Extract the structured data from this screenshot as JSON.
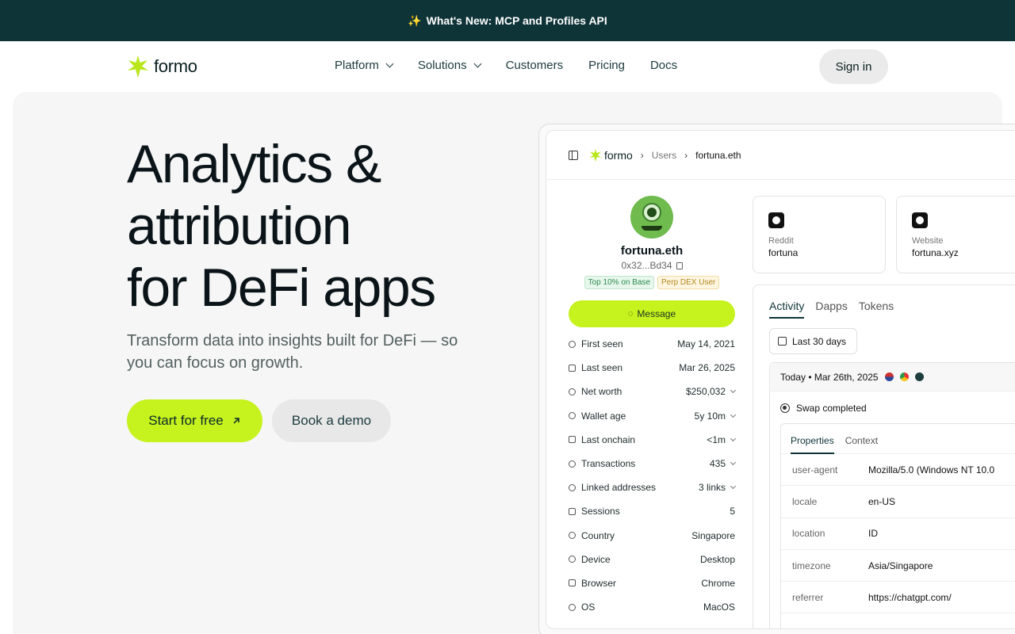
{
  "announcement": {
    "icon": "sparkles-icon",
    "text": "What's New: MCP and Profiles API"
  },
  "nav": {
    "logo": "formo",
    "items": [
      {
        "label": "Platform",
        "dropdown": true
      },
      {
        "label": "Solutions",
        "dropdown": true
      },
      {
        "label": "Customers",
        "dropdown": false
      },
      {
        "label": "Pricing",
        "dropdown": false
      },
      {
        "label": "Docs",
        "dropdown": false
      }
    ],
    "signin": "Sign in"
  },
  "hero": {
    "headline": [
      "Analytics &",
      "attribution",
      "for DeFi apps"
    ],
    "subtitle": "Transform data into insights built for DeFi — so you can focus on growth.",
    "primary_cta": "Start for free",
    "secondary_cta": "Book a demo"
  },
  "app": {
    "logo": "formo",
    "breadcrumb": [
      "Users",
      "fortuna.eth"
    ],
    "profile": {
      "name": "fortuna.eth",
      "address": "0x32...Bd34",
      "tags": [
        "Top 10% on Base",
        "Perp DEX User"
      ],
      "message_button": "Message",
      "rows": [
        {
          "label": "First seen",
          "value": "May 14, 2021",
          "expand": false
        },
        {
          "label": "Last seen",
          "value": "Mar 26, 2025",
          "expand": false
        },
        {
          "label": "Net worth",
          "value": "$250,032",
          "expand": true
        },
        {
          "label": "Wallet age",
          "value": "5y 10m",
          "expand": true
        },
        {
          "label": "Last onchain",
          "value": "<1m",
          "expand": true
        },
        {
          "label": "Transactions",
          "value": "435",
          "expand": true
        },
        {
          "label": "Linked addresses",
          "value": "3 links",
          "expand": true
        },
        {
          "label": "Sessions",
          "value": "5",
          "expand": false
        },
        {
          "label": "Country",
          "value": "Singapore",
          "expand": false
        },
        {
          "label": "Device",
          "value": "Desktop",
          "expand": false
        },
        {
          "label": "Browser",
          "value": "Chrome",
          "expand": false
        },
        {
          "label": "OS",
          "value": "MacOS",
          "expand": false
        }
      ]
    },
    "cards": [
      {
        "label": "Reddit",
        "value": "fortuna",
        "icon": "reddit-icon"
      },
      {
        "label": "Website",
        "value": "fortuna.xyz",
        "icon": "globe-icon"
      }
    ],
    "tabs": [
      "Activity",
      "Dapps",
      "Tokens"
    ],
    "date_range": "Last 30 days",
    "feed": {
      "header": "Today • Mar 26th, 2025",
      "event": "Swap completed",
      "prop_tabs": [
        "Properties",
        "Context"
      ],
      "properties": [
        {
          "key": "user-agent",
          "value": "Mozilla/5.0 (Windows NT 10.0"
        },
        {
          "key": "locale",
          "value": "en-US"
        },
        {
          "key": "location",
          "value": "ID"
        },
        {
          "key": "timezone",
          "value": "Asia/Singapore"
        },
        {
          "key": "referrer",
          "value": "https://chatgpt.com/"
        }
      ]
    }
  },
  "colors": {
    "brand_dark": "#0f3438",
    "accent_lime": "#c6f21e"
  }
}
